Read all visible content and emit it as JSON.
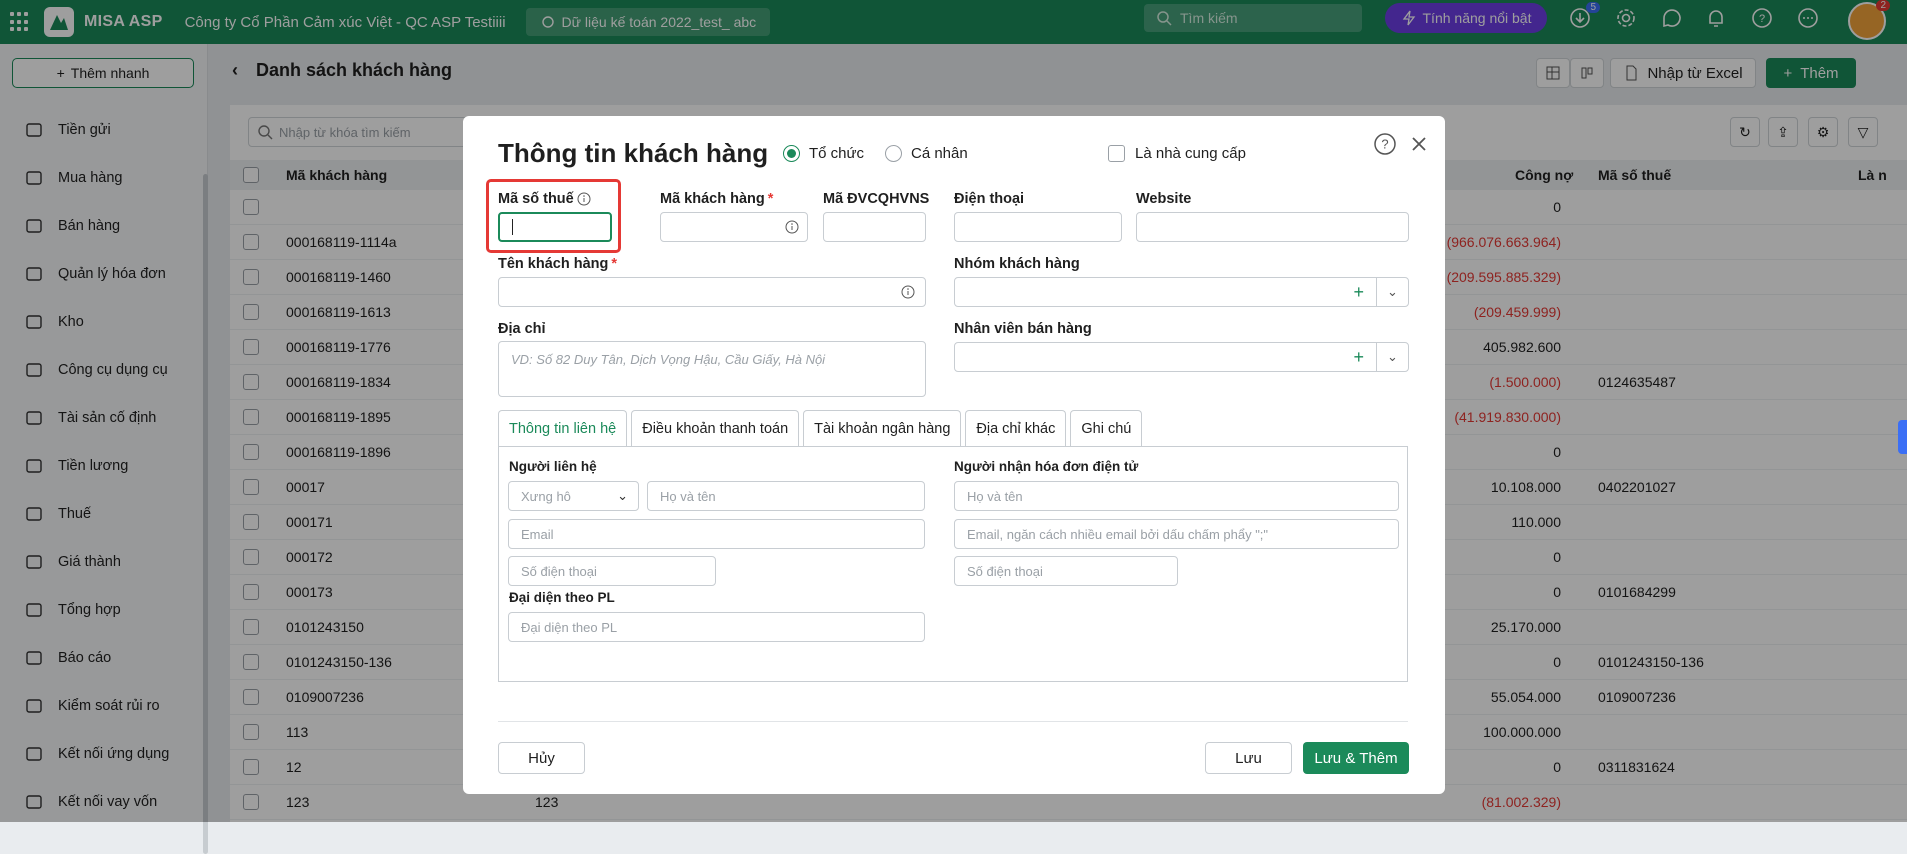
{
  "topbar": {
    "brand": "MISA ASP",
    "company": "Công ty Cổ Phần Cảm xúc Việt - QC ASP Testiiii",
    "database": "Dữ liệu kế toán 2022_test_ abc",
    "search_placeholder": "Tìm kiếm",
    "feature_label": "Tính năng nổi bật",
    "download_badge": "5",
    "avatar_badge": "2"
  },
  "sidebar": {
    "quick_add": "Thêm nhanh",
    "items": [
      {
        "label": "Tiền gửi",
        "icon": "bank-icon"
      },
      {
        "label": "Mua hàng",
        "icon": "shopping-bag-icon"
      },
      {
        "label": "Bán hàng",
        "icon": "cart-icon"
      },
      {
        "label": "Quản lý hóa đơn",
        "icon": "invoice-icon"
      },
      {
        "label": "Kho",
        "icon": "warehouse-icon"
      },
      {
        "label": "Công cụ dụng cụ",
        "icon": "tools-icon"
      },
      {
        "label": "Tài sản cố định",
        "icon": "truck-icon"
      },
      {
        "label": "Tiền lương",
        "icon": "salary-icon"
      },
      {
        "label": "Thuế",
        "icon": "tax-icon"
      },
      {
        "label": "Giá thành",
        "icon": "price-icon"
      },
      {
        "label": "Tổng hợp",
        "icon": "summary-icon"
      },
      {
        "label": "Báo cáo",
        "icon": "report-icon"
      },
      {
        "label": "Kiểm soát rủi ro",
        "icon": "risk-icon"
      },
      {
        "label": "Kết nối ứng dụng",
        "icon": "connect-icon"
      },
      {
        "label": "Kết nối vay vốn",
        "icon": "loan-icon"
      }
    ]
  },
  "page": {
    "title": "Danh sách khách hàng",
    "import_label": "Nhập từ Excel",
    "add_label": "Thêm",
    "search_placeholder": "Nhập từ khóa tìm kiếm"
  },
  "table": {
    "columns": [
      "Mã khách hàng",
      "Công nợ",
      "Mã số thuế",
      "Là n"
    ],
    "rows": [
      {
        "code": "",
        "debt": "0",
        "tax": ""
      },
      {
        "code": "000168119-1114a",
        "debt": "(966.076.663.964)",
        "tax": ""
      },
      {
        "code": "000168119-1460",
        "debt": "(209.595.885.329)",
        "tax": ""
      },
      {
        "code": "000168119-1613",
        "debt": "(209.459.999)",
        "tax": ""
      },
      {
        "code": "000168119-1776",
        "debt": "405.982.600",
        "tax": ""
      },
      {
        "code": "000168119-1834",
        "debt": "(1.500.000)",
        "tax": "0124635487"
      },
      {
        "code": "000168119-1895",
        "debt": "(41.919.830.000)",
        "tax": ""
      },
      {
        "code": "000168119-1896",
        "debt": "0",
        "tax": ""
      },
      {
        "code": "00017",
        "debt": "10.108.000",
        "tax": "0402201027"
      },
      {
        "code": "000171",
        "debt": "110.000",
        "tax": ""
      },
      {
        "code": "000172",
        "debt": "0",
        "tax": ""
      },
      {
        "code": "000173",
        "debt": "0",
        "tax": "0101684299"
      },
      {
        "code": "0101243150",
        "debt": "25.170.000",
        "tax": ""
      },
      {
        "code": "0101243150-136",
        "debt": "0",
        "tax": "0101243150-136"
      },
      {
        "code": "0109007236",
        "debt": "55.054.000",
        "tax": "0109007236"
      },
      {
        "code": "113",
        "debt": "100.000.000",
        "tax": ""
      },
      {
        "code": "12",
        "debt": "0",
        "tax": "0311831624"
      },
      {
        "code": "123",
        "name": "123",
        "debt": "(81.002.329)",
        "tax": ""
      }
    ]
  },
  "modal": {
    "title": "Thông tin khách hàng",
    "type_org": "Tổ chức",
    "type_person": "Cá nhân",
    "supplier_label": "Là nhà cung cấp",
    "fields": {
      "tax_code": "Mã số thuế",
      "customer_code": "Mã khách hàng",
      "unit_code": "Mã ĐVCQHVNS",
      "phone": "Điện thoại",
      "website": "Website",
      "customer_name": "Tên khách hàng",
      "customer_group": "Nhóm khách hàng",
      "address": "Địa chỉ",
      "address_placeholder": "VD: Số 82 Duy Tân, Dịch Vọng Hậu, Cầu Giấy, Hà Nội",
      "sales_staff": "Nhân viên bán hàng",
      "required_mark": "*"
    },
    "tabs": [
      "Thông tin liên hệ",
      "Điều khoản thanh toán",
      "Tài khoản ngân hàng",
      "Địa chỉ khác",
      "Ghi chú"
    ],
    "contact": {
      "section": "Người liên hệ",
      "salutation": "Xưng hô",
      "fullname": "Họ và tên",
      "email": "Email",
      "phone": "Số điện thoại",
      "legal_rep": "Đại diện theo PL",
      "legal_rep_placeholder": "Đại diện theo PL"
    },
    "einvoice": {
      "section": "Người nhận hóa đơn điện tử",
      "fullname": "Họ và tên",
      "email": "Email, ngăn cách nhiều email bởi dấu chấm phẩy \";\"",
      "phone": "Số điện thoại"
    },
    "buttons": {
      "cancel": "Hủy",
      "save": "Lưu",
      "save_add": "Lưu & Thêm"
    }
  },
  "colors": {
    "primary": "#1b8a5a",
    "negative": "#e53935",
    "feature": "#6c3ee6"
  }
}
